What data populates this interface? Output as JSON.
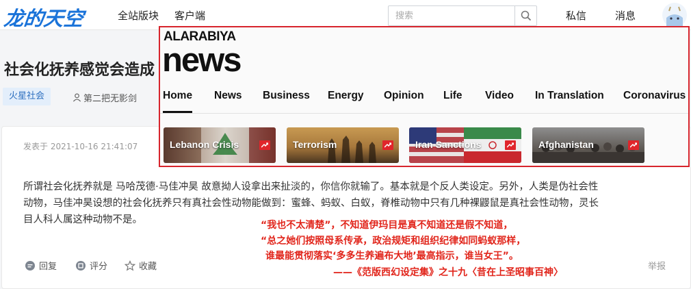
{
  "topbar": {
    "logo": "龙的天空",
    "nav": [
      "全站版块",
      "客户端"
    ],
    "search_placeholder": "搜索",
    "messages": "私信",
    "notifications": "消息"
  },
  "article": {
    "title": "社会化抚养感觉会造成",
    "tag": "火星社会",
    "author": "第二把无影剑",
    "posted_at": "发表于 2021-10-16 21:41:07",
    "body_lines": [
      "所谓社会化抚养就是 马哈茂德·马佳冲昊 故意拗人设拿出来扯淡的，你信你就输了。基本就是个反人类设定。另外，人类是伪社会性",
      "动物，马佳冲昊设想的社会化抚养只有真社会性动物能做到：蜜蜂、蚂蚁、白蚁，脊椎动物中只有几种裸鼹鼠是真社会性动物，灵长",
      "目人科人属这种动物不是。"
    ],
    "quote_lines": [
      "“我也不太清楚”，不知道伊玛目是真不知道还是假不知道，",
      "“总之她们按照母系传承，政治规矩和组织纪律如同蚂蚁那样，",
      "谁最能贯彻落实‘多多生养遍布大地’最高指示，谁当女王”。",
      "——《范版西幻设定集》之十九〈昔在上圣昭事百神〉"
    ],
    "actions": {
      "reply": "回复",
      "rate": "评分",
      "favorite": "收藏",
      "report": "举报"
    }
  },
  "overlay": {
    "logo_top": "ALARABIYA",
    "logo_main": "news",
    "nav": [
      "Home",
      "News",
      "Business",
      "Energy",
      "Opinion",
      "Life",
      "Video",
      "In Translation",
      "Coronavirus"
    ],
    "active_nav": "Home",
    "tiles": [
      {
        "label": "Lebanon Crisis"
      },
      {
        "label": "Terrorism"
      },
      {
        "label": "Iran Sanctions"
      },
      {
        "label": "Afghanistan"
      }
    ],
    "accent_color": "#d7242c"
  }
}
